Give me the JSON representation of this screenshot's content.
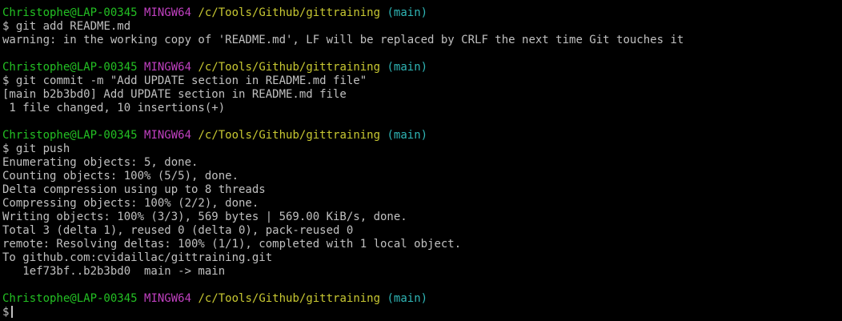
{
  "colors": {
    "background": "#000000",
    "text": "#c0c0c0",
    "user_host": "#23c023",
    "shell": "#c040c0",
    "path": "#c8c832",
    "branch": "#2fb6b6"
  },
  "prompt": {
    "user_host": "Christophe@LAP-00345",
    "shell": "MINGW64",
    "path": "/c/Tools/Github/gittraining",
    "branch": "(main)",
    "symbol": "$"
  },
  "blocks": [
    {
      "command": "git add README.md",
      "output": [
        "warning: in the working copy of 'README.md', LF will be replaced by CRLF the next time Git touches it"
      ]
    },
    {
      "command": "git commit -m \"Add UPDATE section in README.md file\"",
      "output": [
        "[main b2b3bd0] Add UPDATE section in README.md file",
        " 1 file changed, 10 insertions(+)"
      ]
    },
    {
      "command": "git push",
      "output": [
        "Enumerating objects: 5, done.",
        "Counting objects: 100% (5/5), done.",
        "Delta compression using up to 8 threads",
        "Compressing objects: 100% (2/2), done.",
        "Writing objects: 100% (3/3), 569 bytes | 569.00 KiB/s, done.",
        "Total 3 (delta 1), reused 0 (delta 0), pack-reused 0",
        "remote: Resolving deltas: 100% (1/1), completed with 1 local object.",
        "To github.com:cvidaillac/gittraining.git",
        "   1ef73bf..b2b3bd0  main -> main"
      ]
    }
  ]
}
